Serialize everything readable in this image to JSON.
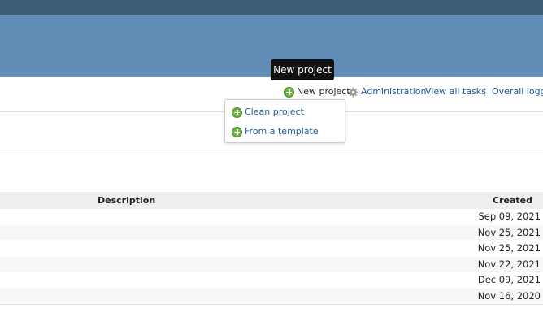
{
  "colors": {
    "topbar": "#3e5b76",
    "header": "#628db6",
    "link": "#1f5799",
    "tooltip_bg": "#111111",
    "plus_icon": "#6cb33f"
  },
  "tooltip": {
    "text": "New project"
  },
  "nav": {
    "new_project": {
      "label": "New project",
      "icon": "plus-circle-icon"
    },
    "administration": {
      "label": "Administration",
      "icon": "gear-icon"
    },
    "view_all_tasks": {
      "label": "View all tasks"
    },
    "separator": "|",
    "overall_logged": {
      "label": "Overall logge"
    }
  },
  "new_project_menu": {
    "items": [
      {
        "label": "Clean project",
        "icon": "plus-circle-icon"
      },
      {
        "label": "From a template",
        "icon": "plus-circle-icon"
      }
    ]
  },
  "table": {
    "headers": {
      "description": "Description",
      "created": "Created"
    },
    "rows": [
      {
        "description": "",
        "created": "Sep 09, 2021"
      },
      {
        "description": "",
        "created": "Nov 25, 2021"
      },
      {
        "description": "",
        "created": "Nov 25, 2021"
      },
      {
        "description": "",
        "created": "Nov 22, 2021"
      },
      {
        "description": "",
        "created": "Dec 09, 2021"
      },
      {
        "description": "",
        "created": "Nov 16, 2020"
      }
    ]
  }
}
